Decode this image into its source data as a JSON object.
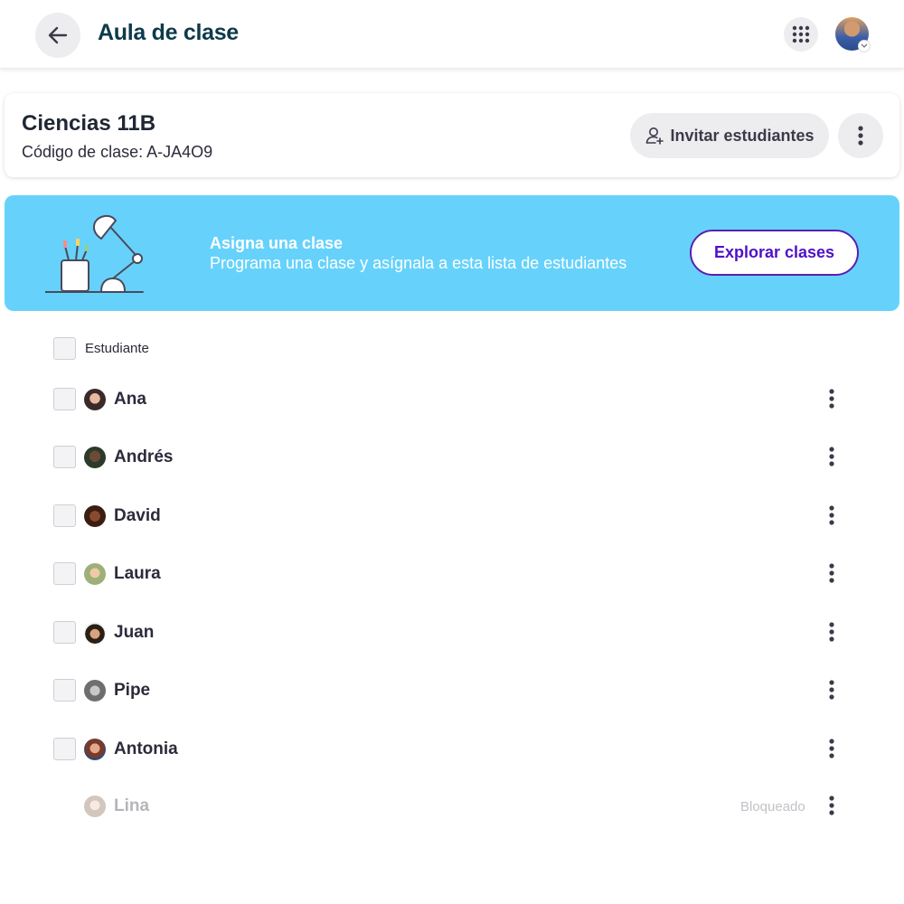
{
  "header": {
    "title": "Aula de clase",
    "back_icon": "arrow-left-icon",
    "apps_icon": "apps-grid-icon"
  },
  "class_card": {
    "name": "Ciencias 11B",
    "code": "Código de clase: A-JA4O9",
    "invite_label": "Invitar estudiantes"
  },
  "banner": {
    "title": "Asigna una clase",
    "subtitle": "Programa una clase y asígnala a esta lista de estudiantes",
    "button_label": "Explorar clases",
    "bg_color": "#66d2fb",
    "button_color": "#5010c8"
  },
  "list": {
    "header_label": "Estudiante",
    "students": [
      {
        "name": "Ana"
      },
      {
        "name": "Andrés"
      },
      {
        "name": "David"
      },
      {
        "name": "Laura"
      },
      {
        "name": "Juan"
      },
      {
        "name": "Pipe"
      },
      {
        "name": "Antonia"
      },
      {
        "name": "Lina",
        "status": "Bloqueado"
      }
    ]
  }
}
